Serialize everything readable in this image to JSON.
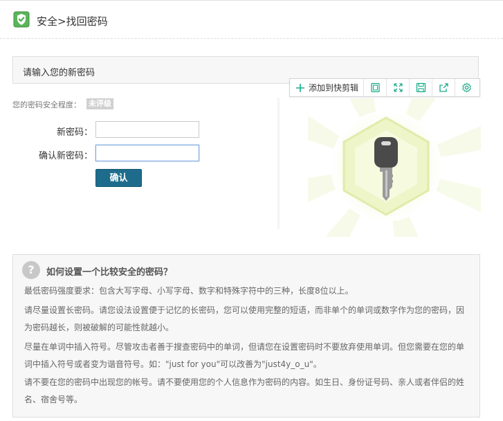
{
  "header": {
    "title": "安全>找回密码",
    "icon": "shield-check-icon",
    "accent": "#4cae4c"
  },
  "panel": {
    "title": "请输入您的新密码"
  },
  "toolbar": {
    "add_label": "添加到快剪辑",
    "add_icon": "plus-icon",
    "buttons": [
      "copy-icon",
      "expand-icon",
      "save-icon",
      "share-icon",
      "settings-icon"
    ],
    "icon_color": "#1aaa8a"
  },
  "form": {
    "strength_label": "您的密码安全程度：",
    "strength_value": "未评级",
    "new_password_label": "新密码：",
    "new_password_value": "",
    "confirm_password_label": "确认新密码：",
    "confirm_password_value": "",
    "submit_label": "确认",
    "submit_color": "#1e6c8c"
  },
  "tips": {
    "icon": "question-icon",
    "title": "如何设置一个比较安全的密码？",
    "items": [
      "最低密码强度要求：包含大写字母、小写字母、数字和特殊字符中的三种，长度8位以上。",
      "请尽量设置长密码。请您设法设置便于记忆的长密码，您可以使用完整的短语，而非单个的单词或数字作为您的密码，因为密码越长，则被破解的可能性就越小。",
      "尽量在单词中插入符号。尽管攻击者善于搜查密码中的单词，但请您在设置密码时不要放弃使用单词。但您需要在您的单词中插入符号或者变为谐音符号。如：\"just for you\"可以改善为\"just4y_o_u\"。",
      "请不要在您的密码中出现您的帐号。请不要使用您的个人信息作为密码的内容。如生日、身份证号码、亲人或者伴侣的姓名、宿舍号等。"
    ]
  }
}
